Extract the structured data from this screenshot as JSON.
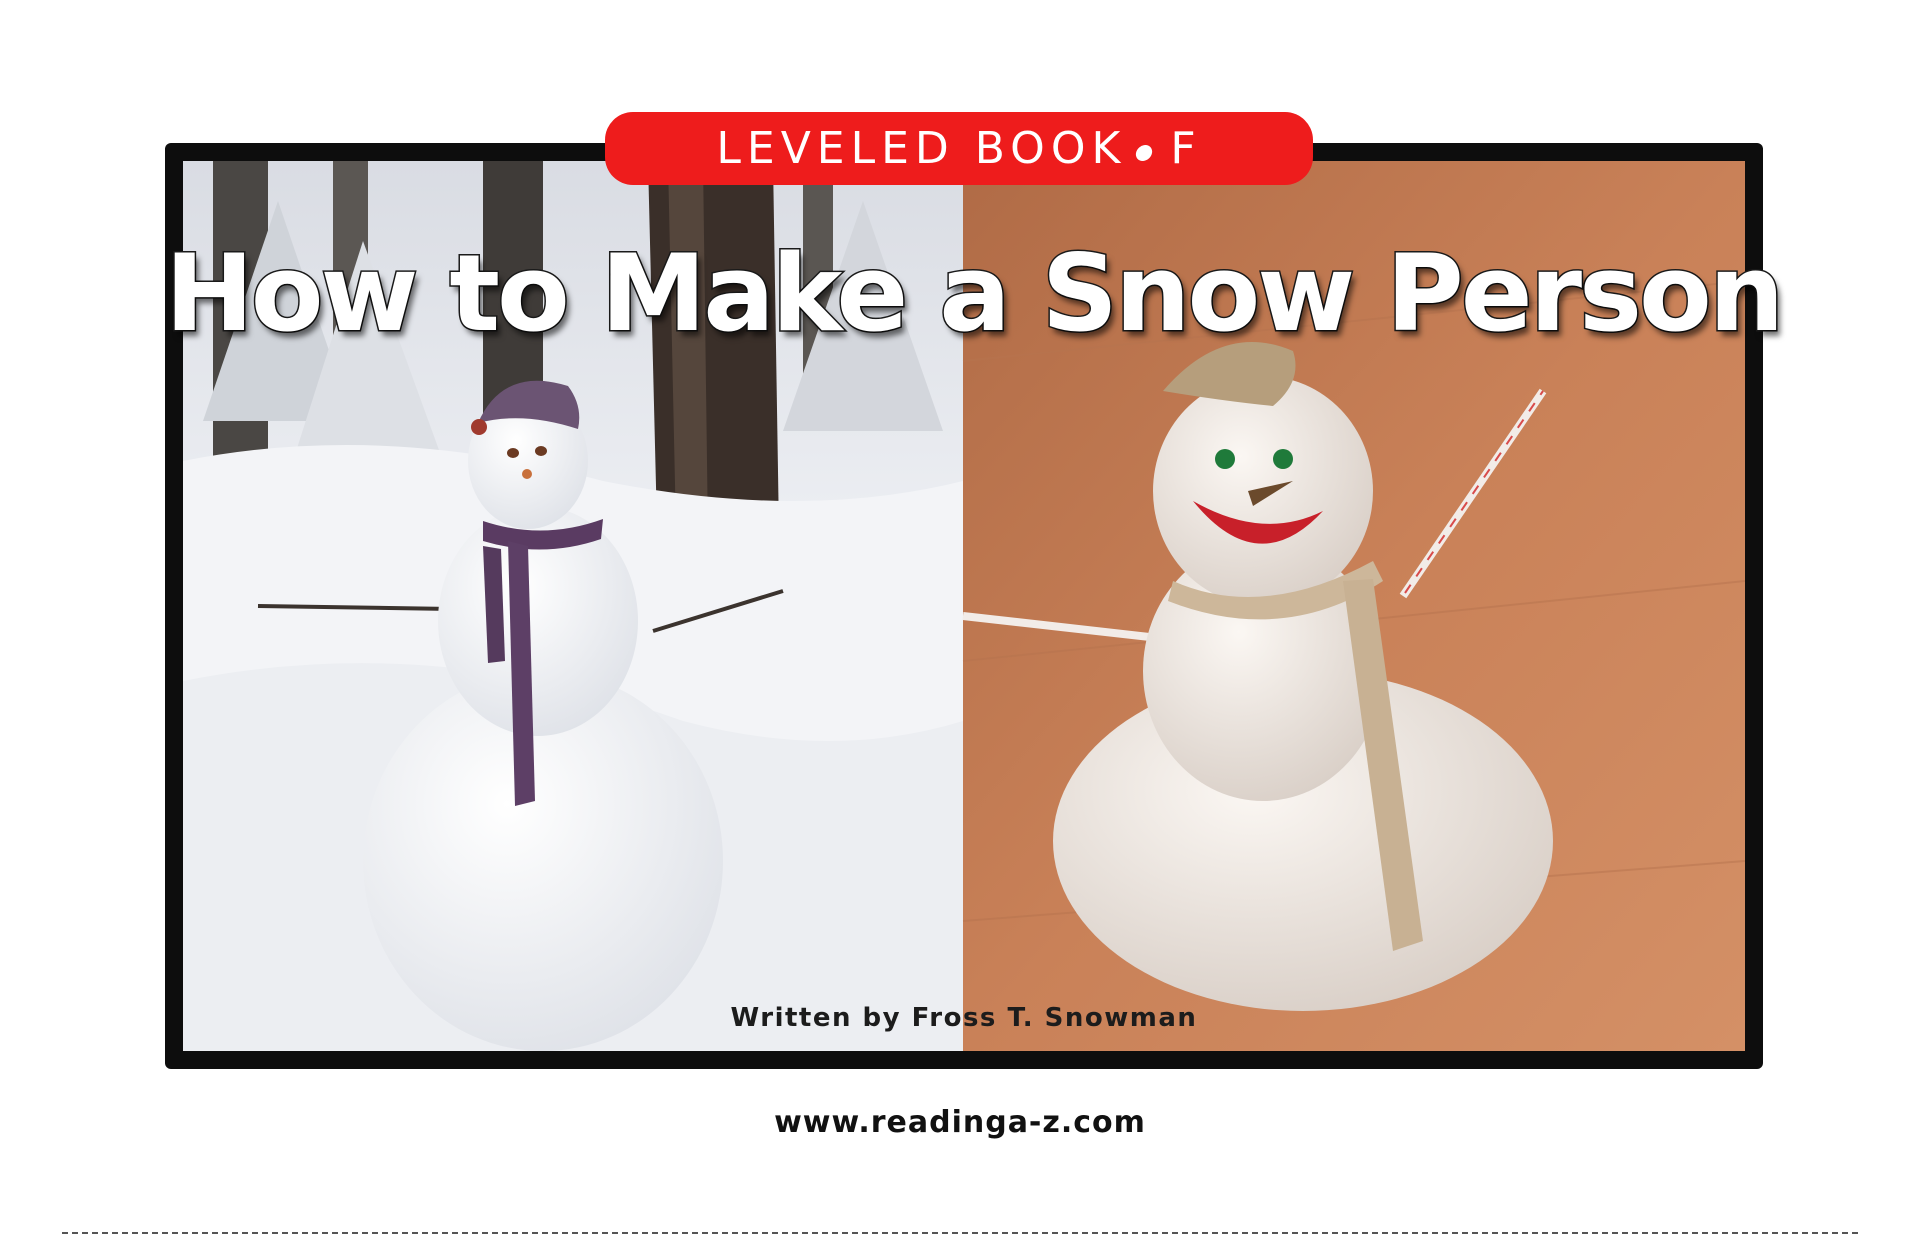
{
  "cover": {
    "series_label": "LEVELED BOOK",
    "level": "F",
    "title": "How to Make a Snow Person",
    "byline": "Written by Fross T. Snowman",
    "website": "www.readinga-z.com"
  }
}
